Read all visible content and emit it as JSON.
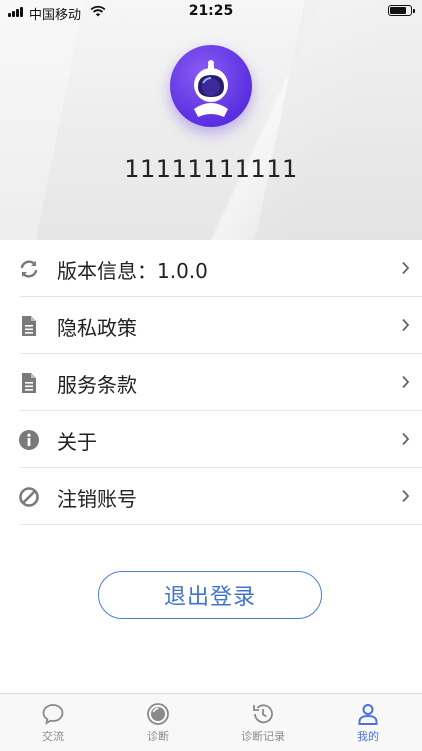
{
  "status_bar": {
    "carrier": "中国移动",
    "time": "21:25"
  },
  "profile": {
    "phone": "11111111111"
  },
  "menu": {
    "items": [
      {
        "label": "版本信息：1.0.0",
        "icon": "refresh-icon"
      },
      {
        "label": "隐私政策",
        "icon": "document-icon"
      },
      {
        "label": "服务条款",
        "icon": "document-icon"
      },
      {
        "label": "关于",
        "icon": "info-icon"
      },
      {
        "label": "注销账号",
        "icon": "ban-icon"
      }
    ]
  },
  "logout": {
    "label": "退出登录"
  },
  "tabbar": {
    "tabs": [
      {
        "label": "交流",
        "icon": "chat-icon",
        "active": false
      },
      {
        "label": "诊断",
        "icon": "diagnose-icon",
        "active": false
      },
      {
        "label": "诊断记录",
        "icon": "history-icon",
        "active": false
      },
      {
        "label": "我的",
        "icon": "user-icon",
        "active": true
      }
    ]
  },
  "colors": {
    "accent": "#4a72d8",
    "avatar_purple": "#5a2fe0",
    "icon_gray": "#7a7a7a"
  }
}
